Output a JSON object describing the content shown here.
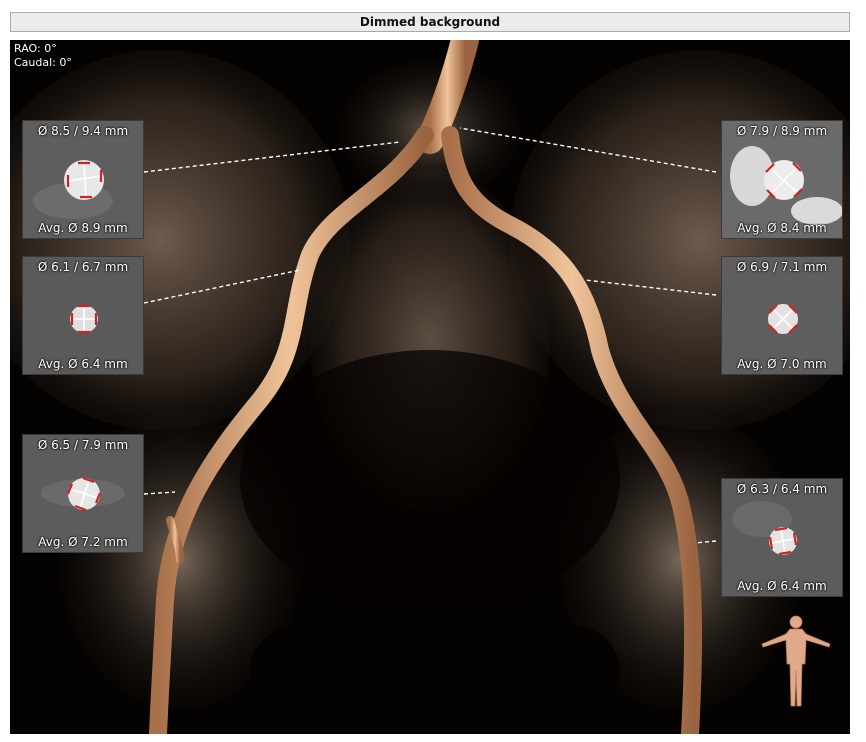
{
  "title_bar": {
    "label": "Dimmed background"
  },
  "orientation": {
    "rao": "RAO: 0°",
    "caudal": "Caudal: 0°"
  },
  "cross_sections": [
    {
      "id": "left-1",
      "diameters": "Ø 8.5 / 9.4 mm",
      "average": "Avg. Ø 8.9 mm"
    },
    {
      "id": "left-2",
      "diameters": "Ø 6.1 / 6.7 mm",
      "average": "Avg. Ø 6.4 mm"
    },
    {
      "id": "left-3",
      "diameters": "Ø 6.5 / 7.9 mm",
      "average": "Avg. Ø 7.2 mm"
    },
    {
      "id": "right-1",
      "diameters": "Ø 7.9 / 8.9 mm",
      "average": "Avg. Ø 8.4 mm"
    },
    {
      "id": "right-2",
      "diameters": "Ø 6.9 / 7.1 mm",
      "average": "Avg. Ø 7.0 mm"
    },
    {
      "id": "right-3",
      "diameters": "Ø 6.3 / 6.4 mm",
      "average": "Avg. Ø 6.4 mm"
    }
  ],
  "colors": {
    "vessel": "#d9a47a",
    "measure_marker": "#d42020",
    "connector": "#ffffff",
    "avatar_skin": "#e0a98a"
  },
  "icons": {
    "orientation_avatar": "human-figure-icon"
  }
}
